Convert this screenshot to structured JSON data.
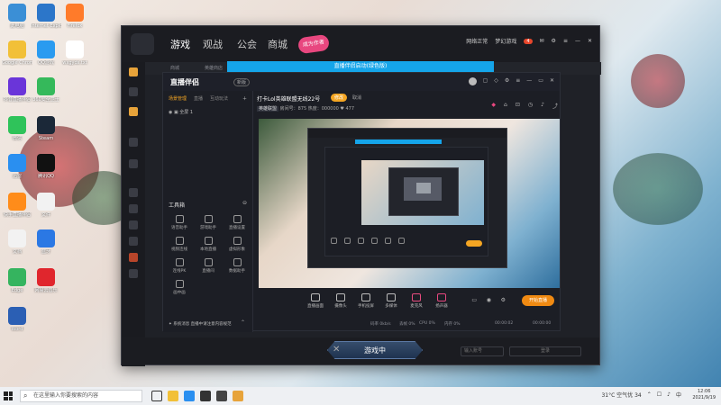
{
  "desktop": {
    "icons": [
      {
        "label": "此电脑",
        "color": "#3b8fd6"
      },
      {
        "label": "Internet Explorer",
        "color": "#2c76c9"
      },
      {
        "label": "Firefox",
        "color": "#ff7b2a"
      },
      {
        "label": "Google Chrome",
        "color": "#f2c038"
      },
      {
        "label": "QQ游戏",
        "color": "#2a9bf0"
      },
      {
        "label": "wxgyds.txt",
        "color": "#ffffff"
      },
      {
        "label": "抖音直播伴侣",
        "color": "#6a35d9"
      },
      {
        "label": "360安全卫士",
        "color": "#35b95b"
      },
      {
        "label": "微信",
        "color": "#2fc35a"
      },
      {
        "label": "Steam",
        "color": "#1b2838"
      },
      {
        "label": "迅雷",
        "color": "#2a8ff0"
      },
      {
        "label": "腾讯QQ",
        "color": "#111111"
      },
      {
        "label": "快手直播伴侣",
        "color": "#ff8c1a"
      },
      {
        "label": "文件",
        "color": "#f2f2f2"
      },
      {
        "label": "文档",
        "color": "#f2f2f2"
      },
      {
        "label": "蓝牙",
        "color": "#2b78e4"
      },
      {
        "label": "Edge",
        "color": "#35b45f"
      },
      {
        "label": "网易云音乐",
        "color": "#e0262d"
      },
      {
        "label": "Word",
        "color": "#2b5fb4"
      }
    ]
  },
  "app": {
    "nav": [
      "游戏",
      "观战",
      "公会",
      "商城"
    ],
    "promo": "成为作者",
    "subnav": [
      "商城",
      "英雄商店"
    ],
    "top_right": {
      "status": "网络正常",
      "user": "梦幻游戏",
      "coins": "4"
    },
    "play_button": "游戏中",
    "bottom_input": "输入账号",
    "bottom_login": "登录"
  },
  "overlay": {
    "title": "直播伴侣启动(绿色版)"
  },
  "studio": {
    "logo": "直播伴侣",
    "tag": "新版",
    "left_tabs": [
      "场景管理",
      "直播",
      "互动玩法"
    ],
    "scene": "全屏 1",
    "tools_title": "工具箱",
    "tools": [
      {
        "label": "语音助手"
      },
      {
        "label": "游戏助手"
      },
      {
        "label": "直播设置"
      },
      {
        "label": "视频连线"
      },
      {
        "label": "本地直播"
      },
      {
        "label": "虚拟形象"
      },
      {
        "label": "连线PK"
      },
      {
        "label": "直播间"
      },
      {
        "label": "数据助手"
      },
      {
        "label": "画中画"
      }
    ],
    "notice": "✦ 系统消息 直播中请注意内容规范",
    "stream_title": "打卡Lol英雄联盟无线22号",
    "edit": "修改",
    "cancel": "取消",
    "category_label": "英雄联盟",
    "stream_info": "房间号：875 热度：000000 ♥ 477",
    "controls": [
      {
        "label": "直播画面"
      },
      {
        "label": "摄像头"
      },
      {
        "label": "手机投屏"
      },
      {
        "label": "多媒体"
      },
      {
        "label": "麦克风"
      },
      {
        "label": "扬声器"
      }
    ],
    "live_button": "开始直播",
    "status": [
      "码率 0kb/s",
      "丢帧 0%",
      "CPU 0%",
      "内存 0%",
      "00:00:02",
      "00:00:00"
    ]
  },
  "taskbar": {
    "search_placeholder": "在这里输入你要搜索的内容",
    "weather": "31°C 空气优 34",
    "time": "12:06",
    "date": "2021/9/19"
  }
}
